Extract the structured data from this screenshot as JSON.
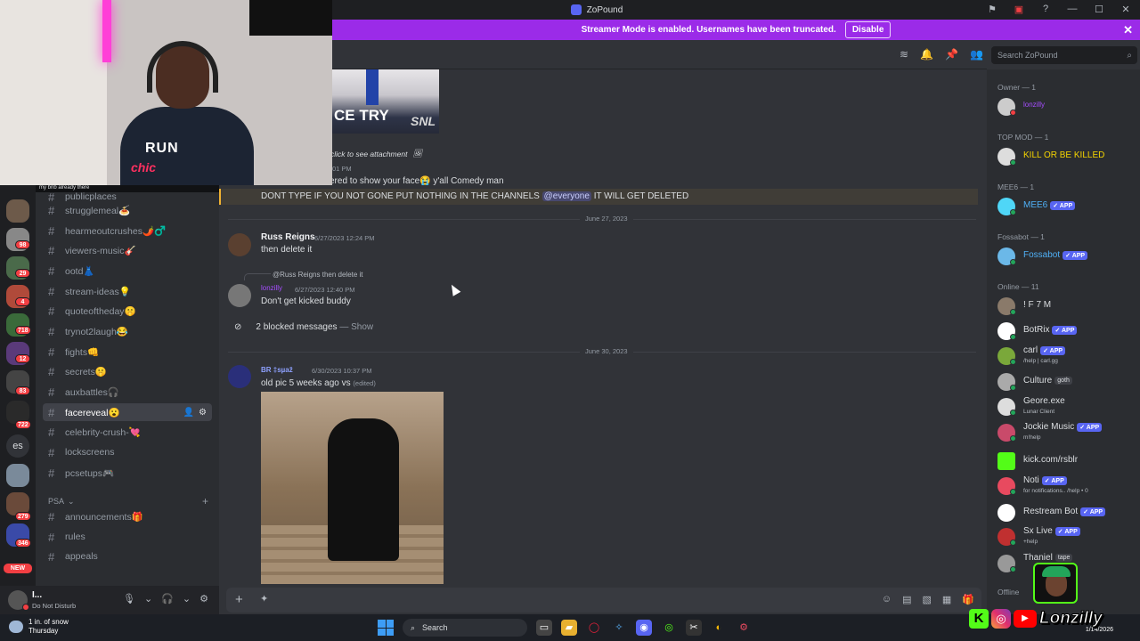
{
  "window": {
    "title": "ZoPound"
  },
  "streamer_banner": {
    "text": "Streamer Mode is enabled. Usernames have been truncated.",
    "button": "Disable"
  },
  "search": {
    "placeholder": "Search ZoPound"
  },
  "sidebar": {
    "tooltip": "my bnb already there",
    "partial_channel": "publicplaces",
    "channels": [
      {
        "name": "strugglemeal🍝"
      },
      {
        "name": "hearmeoutcrushes🌶️♂️"
      },
      {
        "name": "viewers-music🎸"
      },
      {
        "name": "ootd👗"
      },
      {
        "name": "stream-ideas💡"
      },
      {
        "name": "quoteoftheday🤫"
      },
      {
        "name": "trynot2laugh😂"
      },
      {
        "name": "fights👊"
      },
      {
        "name": "secrets🤫"
      },
      {
        "name": "auxbattles🎧"
      },
      {
        "name": "facereveal😮"
      },
      {
        "name": "celebrity-crush-💘"
      },
      {
        "name": "lockscreens"
      },
      {
        "name": "pcsetups🎮"
      }
    ],
    "category": "PSA",
    "psa_channels": [
      {
        "name": "announcements🎁"
      },
      {
        "name": "rules"
      },
      {
        "name": "appeals"
      }
    ]
  },
  "server_rail": {
    "badges": [
      "98",
      "29",
      "4",
      "718",
      "12",
      "83",
      "722",
      "279",
      "346"
    ],
    "text_server": "es",
    "new_label": "NEW"
  },
  "user_panel": {
    "name": "I...",
    "status": "Do Not Disturb"
  },
  "messages": {
    "snl_caption": "CE TRY",
    "snl_logo": "SNL",
    "attach_hint": "click to see attachment",
    "first_ts": "01 PM",
    "first_text": "ered to show your face😭 y'all Comedy man",
    "pinned_text_a": "DONT TYPE IF YOU NOT GONE PUT NOTHING IN THE CHANNELS",
    "pinned_mention": "@everyone",
    "pinned_text_b": "IT WILL GET DELETED",
    "date1": "June 27, 2023",
    "m1_user": "Russ Reigns",
    "m1_ts": "6/27/2023 12:24 PM",
    "m1_text": "then delete it",
    "reply_user": "@Russ Reigns",
    "reply_text": "then delete it",
    "m2_user": "lonzilly",
    "m2_ts": "6/27/2023 12:40 PM",
    "m2_text": "Don't get kicked buddy",
    "blocked_text": "2 blocked messages",
    "blocked_show": "— Show",
    "date2": "June 30, 2023",
    "m3_user": "BR ‡sµaž",
    "m3_ts": "6/30/2023 10:37 PM",
    "m3_text": "old pic 5 weeks ago vs",
    "m3_edited": "(edited)"
  },
  "members": {
    "groups": {
      "owner": "Owner — 1",
      "topmod": "TOP MOD — 1",
      "mee6": "MEE6 — 1",
      "fossabot": "Fossabot — 1",
      "online": "Online — 11",
      "offline": "Offline"
    },
    "owner": "lonzilly",
    "topmod": "KILL OR BE KILLED",
    "mee6": "MEE6",
    "fossabot": "Fossabot",
    "app_tag": "✓ APP",
    "online": [
      {
        "name": "! F 7 M",
        "sub": ""
      },
      {
        "name": "BotRix",
        "sub": "",
        "app": true
      },
      {
        "name": "carl",
        "sub": "/help | carl.gg",
        "app": true
      },
      {
        "name": "Culture",
        "sub": "",
        "tag": "goth"
      },
      {
        "name": "Geore.exe",
        "sub": "Lunar Client"
      },
      {
        "name": "Jockie Music",
        "sub": "m!help",
        "app": true
      },
      {
        "name": "kick.com/rsblr",
        "sub": ""
      },
      {
        "name": "Noti",
        "sub": "for notifications.. /help • 0",
        "app": true
      },
      {
        "name": "Restream Bot",
        "sub": "",
        "app": true
      },
      {
        "name": "Sx Live",
        "sub": "+help",
        "app": true
      },
      {
        "name": "Thaniel",
        "sub": "",
        "tag": "tape"
      }
    ]
  },
  "taskbar": {
    "weather_top": "1 in. of snow",
    "weather_bottom": "Thursday",
    "search": "Search",
    "date": "1/14/2026"
  },
  "overlay": {
    "name": "Lonzilly",
    "webcam_text1": "RUN",
    "webcam_text2": "chic"
  },
  "colors": {
    "accent": "#5865f2",
    "streamer": "#9b2be8",
    "pinned": "#f0b232",
    "owner_name": "#a64dff",
    "topmod_name": "#f5d400",
    "mee6_name": "#4fb0f7",
    "online": "#23a55a"
  }
}
